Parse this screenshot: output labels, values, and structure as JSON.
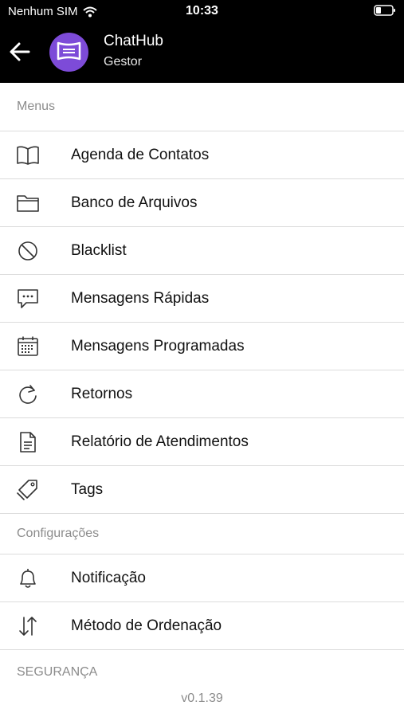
{
  "status_bar": {
    "carrier": "Nenhum SIM",
    "time": "10:33"
  },
  "header": {
    "title": "ChatHub",
    "subtitle": "Gestor"
  },
  "sections": {
    "menus": {
      "title": "Menus",
      "items": [
        {
          "label": "Agenda de Contatos",
          "icon": "book-icon"
        },
        {
          "label": "Banco de Arquivos",
          "icon": "folder-icon"
        },
        {
          "label": "Blacklist",
          "icon": "block-icon"
        },
        {
          "label": "Mensagens Rápidas",
          "icon": "chat-bubble-icon"
        },
        {
          "label": "Mensagens Programadas",
          "icon": "calendar-icon"
        },
        {
          "label": "Retornos",
          "icon": "refresh-icon"
        },
        {
          "label": "Relatório de Atendimentos",
          "icon": "document-icon"
        },
        {
          "label": "Tags",
          "icon": "tags-icon"
        }
      ]
    },
    "settings": {
      "title": "Configurações",
      "items": [
        {
          "label": "Notificação",
          "icon": "bell-icon"
        },
        {
          "label": "Método de Ordenação",
          "icon": "sort-icon"
        }
      ]
    },
    "security": {
      "title": "SEGURANÇA"
    }
  },
  "version": "v0.1.39",
  "colors": {
    "header_bg": "#000000",
    "avatar_bg": "#7d4bd8",
    "divider": "#dcdcdc",
    "muted_text": "#8c8c8c"
  }
}
